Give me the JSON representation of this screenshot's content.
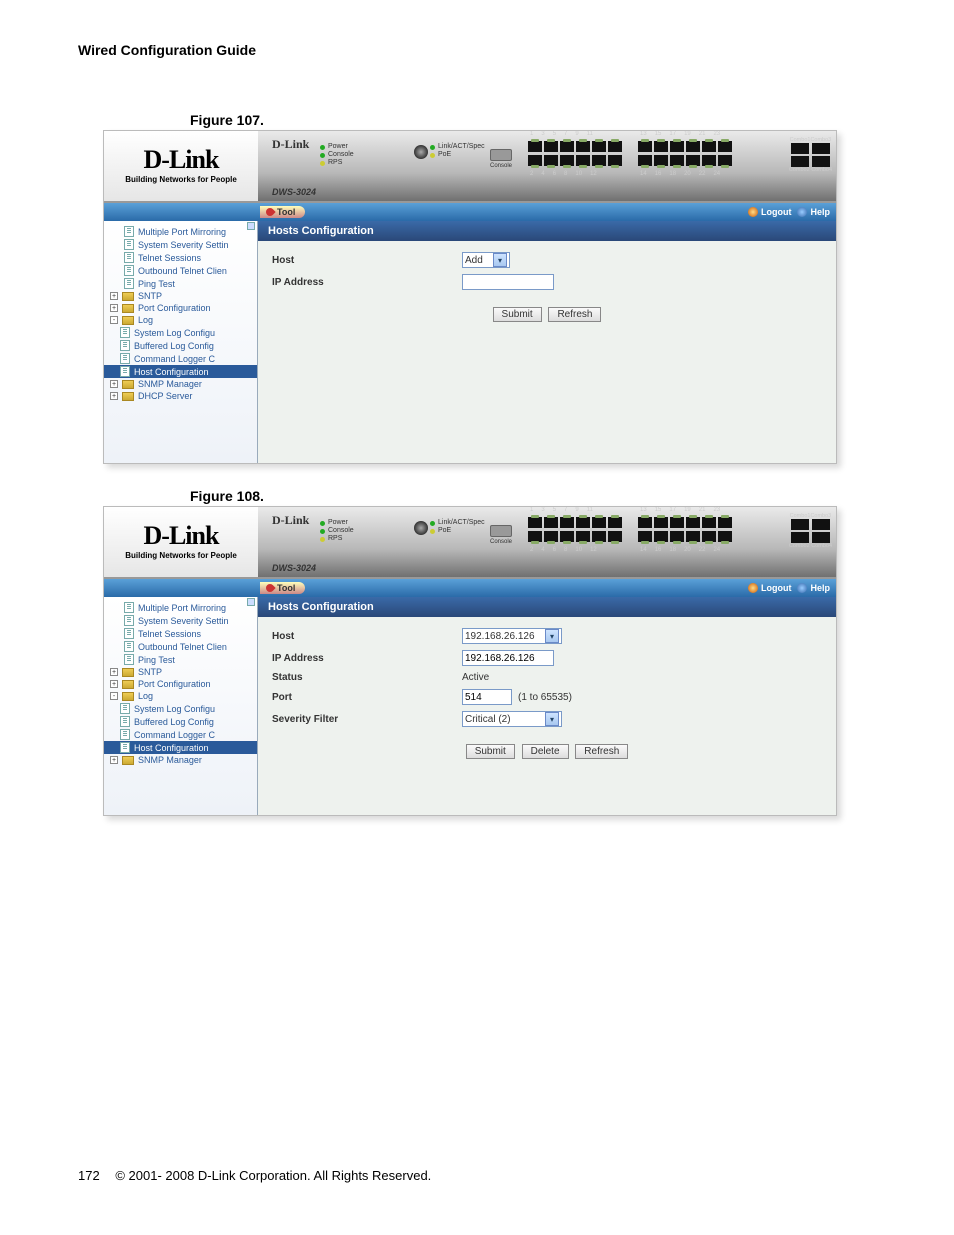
{
  "doc": {
    "header": "Wired Configuration Guide",
    "figure107": "Figure 107.",
    "figure108": "Figure 108.",
    "page_number": "172",
    "copyright": "© 2001- 2008 D-Link Corporation. All Rights Reserved."
  },
  "shared": {
    "logo_text": "D-Link",
    "logo_tagline": "Building Networks for People",
    "graphic_brand": "D-Link",
    "model": "DWS-3024",
    "leds": {
      "power": "Power",
      "console": "Console",
      "rps": "RPS"
    },
    "port_leds": {
      "link": "Link/ACT/Spec",
      "poe": "PoE"
    },
    "console_label": "Console",
    "port_numbers_top": [
      "1",
      "3",
      "5",
      "7",
      "9",
      "11",
      "13",
      "15",
      "17",
      "19",
      "21",
      "23"
    ],
    "port_numbers_bottom": [
      "2",
      "4",
      "6",
      "8",
      "10",
      "12",
      "14",
      "16",
      "18",
      "20",
      "22",
      "24"
    ],
    "combo_top": "Combo1Combo3",
    "combo_bottom": "Combo2 Combo4",
    "tool": "Tool",
    "logout": "Logout",
    "help": "Help"
  },
  "nav107": [
    {
      "label": "Multiple Port Mirroring",
      "type": "doc",
      "indent": 0
    },
    {
      "label": "System Severity Settin",
      "type": "doc",
      "indent": 0
    },
    {
      "label": "Telnet Sessions",
      "type": "doc",
      "indent": 0
    },
    {
      "label": "Outbound Telnet Clien",
      "type": "doc",
      "indent": 0
    },
    {
      "label": "Ping Test",
      "type": "doc",
      "indent": 0
    },
    {
      "label": "SNTP",
      "type": "folder",
      "indent": 0,
      "toggle": "+"
    },
    {
      "label": "Port Configuration",
      "type": "folder",
      "indent": 0,
      "toggle": "+"
    },
    {
      "label": "Log",
      "type": "folder",
      "indent": 0,
      "toggle": "-"
    },
    {
      "label": "System Log Configu",
      "type": "doc",
      "indent": 1
    },
    {
      "label": "Buffered Log Config",
      "type": "doc",
      "indent": 1
    },
    {
      "label": "Command Logger C",
      "type": "doc",
      "indent": 1
    },
    {
      "label": "Host Configuration",
      "type": "doc",
      "indent": 1,
      "selected": true
    },
    {
      "label": "SNMP Manager",
      "type": "folder",
      "indent": 0,
      "toggle": "+"
    },
    {
      "label": "DHCP Server",
      "type": "folder",
      "indent": 0,
      "toggle": "+"
    }
  ],
  "nav108": [
    {
      "label": "Multiple Port Mirroring",
      "type": "doc",
      "indent": 0
    },
    {
      "label": "System Severity Settin",
      "type": "doc",
      "indent": 0
    },
    {
      "label": "Telnet Sessions",
      "type": "doc",
      "indent": 0
    },
    {
      "label": "Outbound Telnet Clien",
      "type": "doc",
      "indent": 0
    },
    {
      "label": "Ping Test",
      "type": "doc",
      "indent": 0
    },
    {
      "label": "SNTP",
      "type": "folder",
      "indent": 0,
      "toggle": "+"
    },
    {
      "label": "Port Configuration",
      "type": "folder",
      "indent": 0,
      "toggle": "+"
    },
    {
      "label": "Log",
      "type": "folder",
      "indent": 0,
      "toggle": "-"
    },
    {
      "label": "System Log Configu",
      "type": "doc",
      "indent": 1
    },
    {
      "label": "Buffered Log Config",
      "type": "doc",
      "indent": 1
    },
    {
      "label": "Command Logger C",
      "type": "doc",
      "indent": 1
    },
    {
      "label": "Host Configuration",
      "type": "doc",
      "indent": 1,
      "selected": true
    },
    {
      "label": "SNMP Manager",
      "type": "folder",
      "indent": 0,
      "toggle": "+"
    }
  ],
  "panel107": {
    "title": "Hosts Configuration",
    "host_label": "Host",
    "host_value": "Add",
    "ip_label": "IP Address",
    "ip_value": "",
    "submit": "Submit",
    "refresh": "Refresh"
  },
  "panel108": {
    "title": "Hosts Configuration",
    "host_label": "Host",
    "host_value": "192.168.26.126",
    "ip_label": "IP Address",
    "ip_value": "192.168.26.126",
    "status_label": "Status",
    "status_value": "Active",
    "port_label": "Port",
    "port_value": "514",
    "port_hint": "(1 to 65535)",
    "sev_label": "Severity Filter",
    "sev_value": "Critical (2)",
    "submit": "Submit",
    "delete": "Delete",
    "refresh": "Refresh"
  }
}
